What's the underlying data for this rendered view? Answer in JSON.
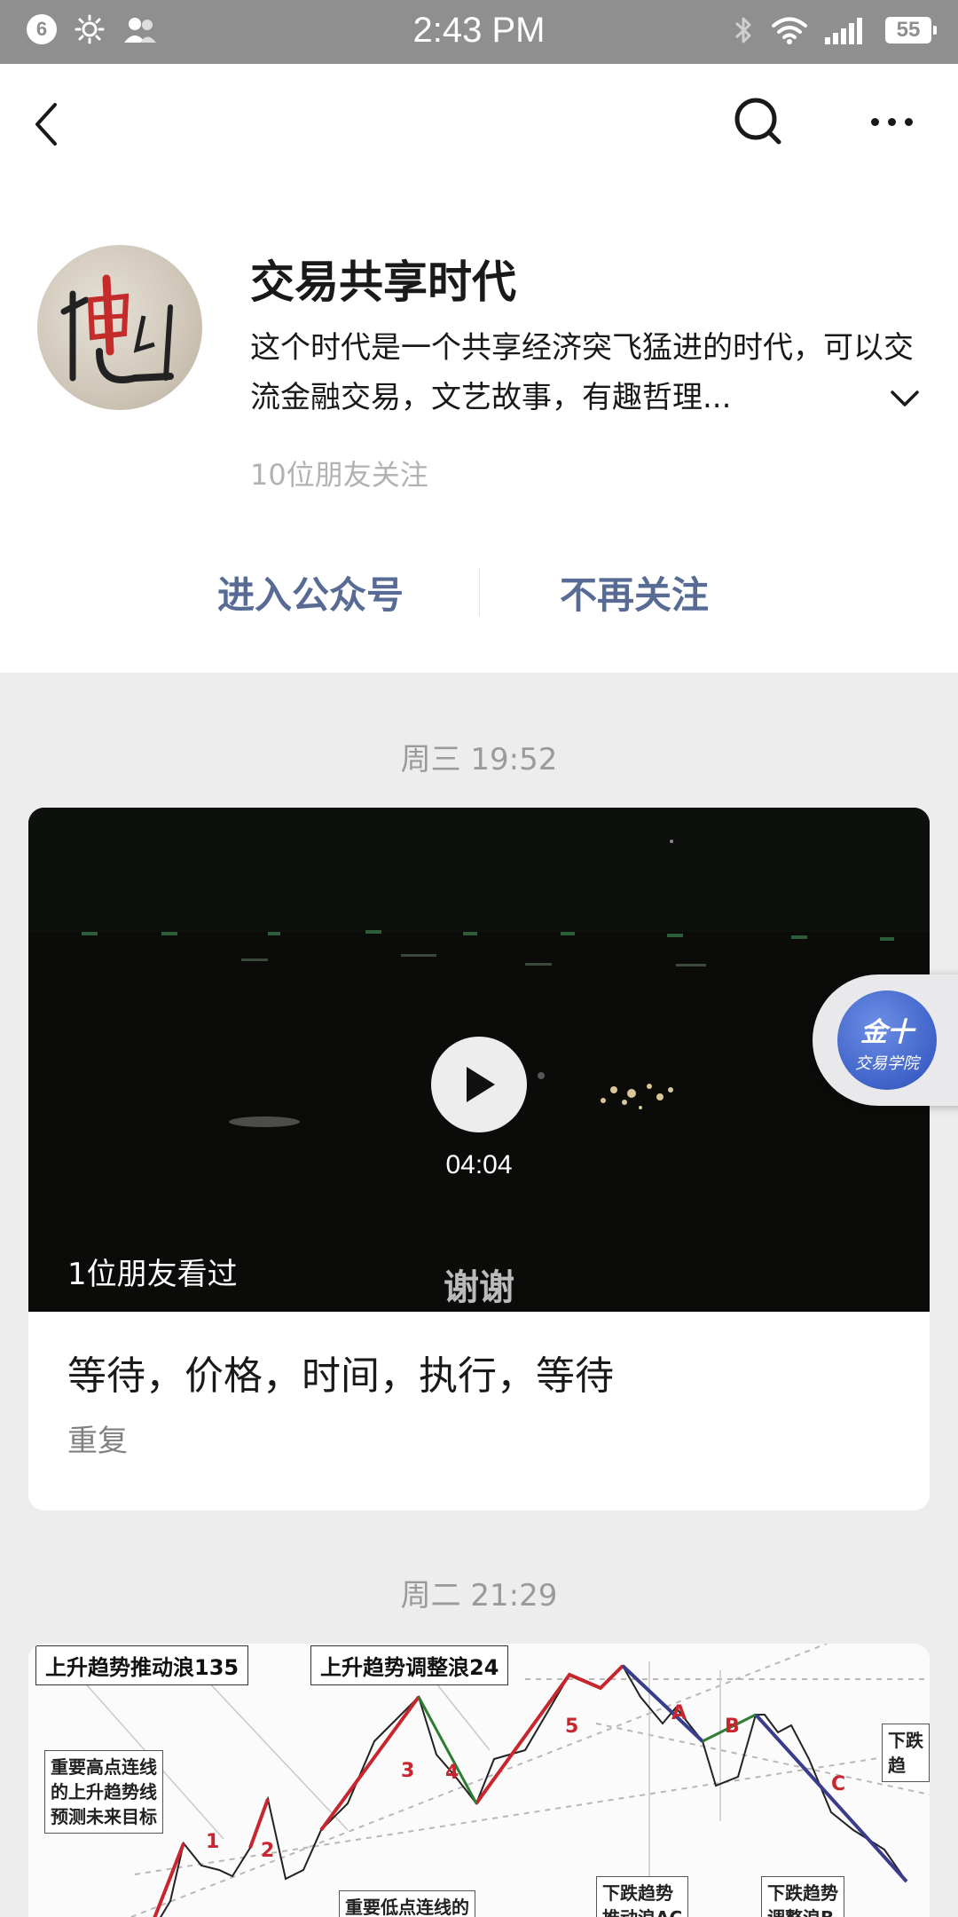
{
  "status_bar": {
    "notification_count": "6",
    "time": "2:43 PM",
    "battery": "55"
  },
  "account": {
    "name": "交易共享时代",
    "description": "这个时代是一个共享经济突飞猛进的时代，可以交流金融交易，文艺故事，有趣哲理...",
    "followers": "10位朋友关注"
  },
  "actions": {
    "enter": "进入公众号",
    "unfollow": "不再关注"
  },
  "posts": [
    {
      "date": "周三 19:52",
      "duration": "04:04",
      "friends_watched": "1位朋友看过",
      "subtitle": "谢谢",
      "title": "等待，价格，时间，执行，等待",
      "digest": "重复"
    },
    {
      "date": "周二 21:29",
      "labels": {
        "up_impulse": "上升趋势推动浪135",
        "up_correction": "上升趋势调整浪24",
        "high_line_1": "重要高点连线",
        "high_line_2": "的上升趋势线",
        "high_line_3": "预测未来目标",
        "low_line": "重要低点连线的",
        "down_impulse_1": "下跌趋势",
        "down_impulse_2": "推动浪AC",
        "down_correction_1": "下跌趋势",
        "down_correction_2": "调整浪B",
        "down_right": "下跌趋"
      },
      "wave_labels": {
        "n1": "1",
        "n2": "2",
        "n3": "3",
        "n4": "4",
        "n5": "5",
        "A": "A",
        "B": "B",
        "C": "C"
      }
    }
  ],
  "floating_button": {
    "line1": "金十",
    "line2": "交易学院"
  }
}
